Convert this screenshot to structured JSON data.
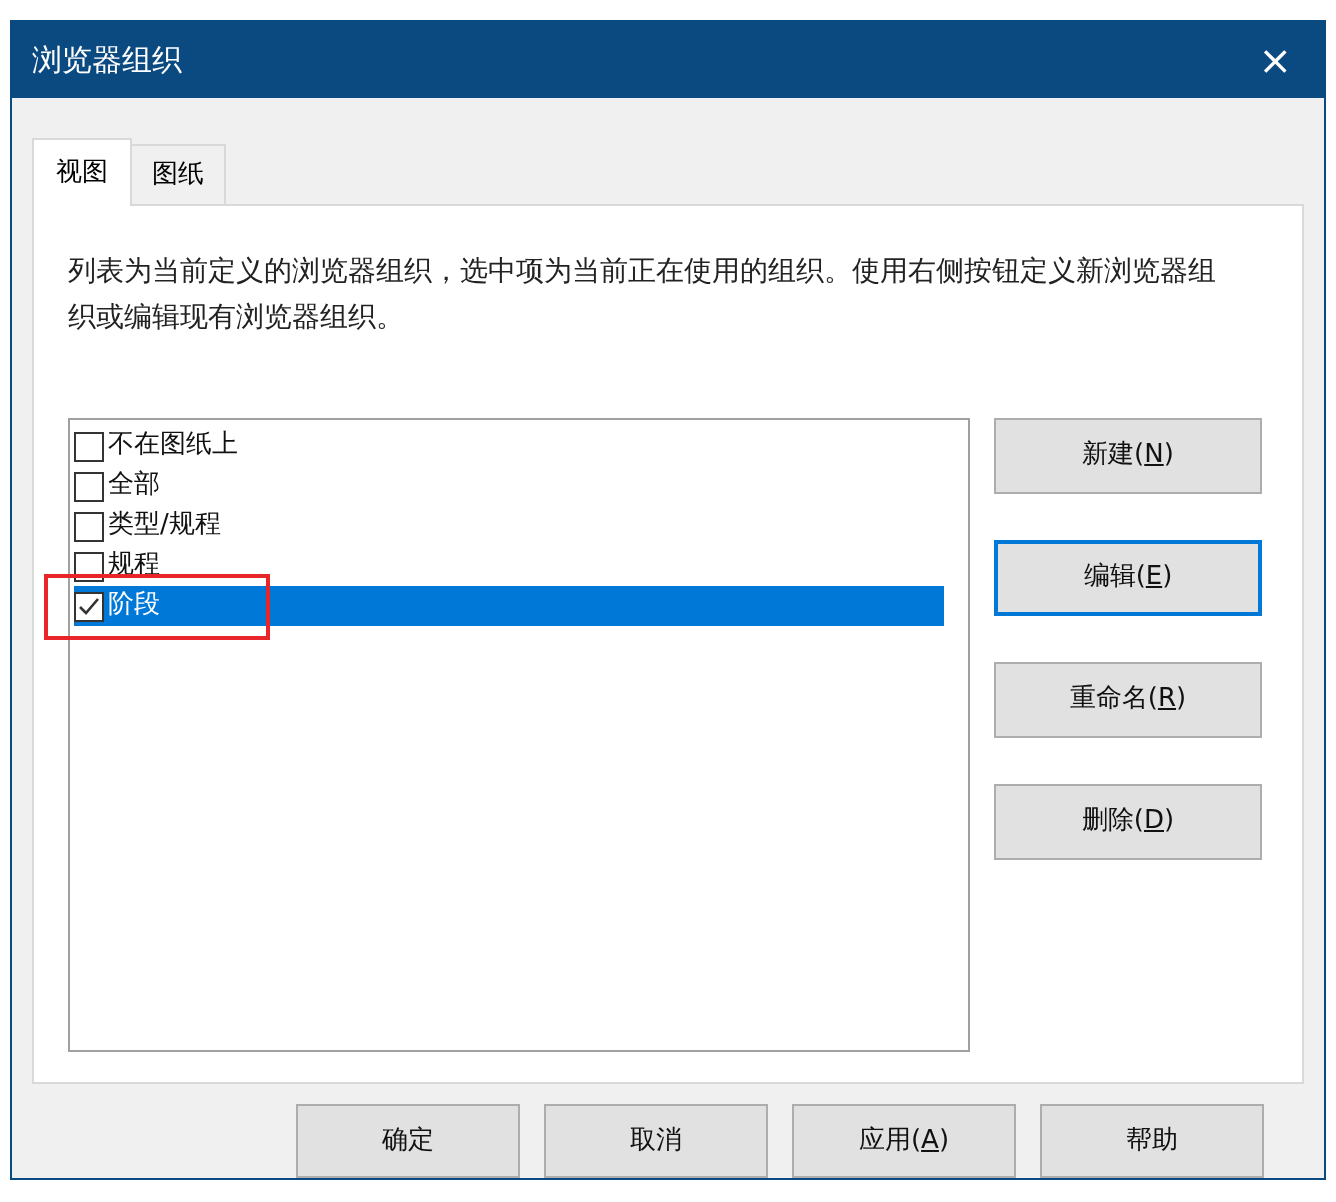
{
  "window": {
    "title": "浏览器组织",
    "close": "×"
  },
  "tabs": [
    {
      "label": "视图",
      "selected": true
    },
    {
      "label": "图纸",
      "selected": false
    }
  ],
  "description": "列表为当前定义的浏览器组织，选中项为当前正在使用的组织。使用右侧按钮定义新浏览器组织或编辑现有浏览器组织。",
  "list": [
    {
      "label": "不在图纸上",
      "checked": false,
      "selected": false,
      "highlighted": false
    },
    {
      "label": "全部",
      "checked": false,
      "selected": false,
      "highlighted": false
    },
    {
      "label": "类型/规程",
      "checked": false,
      "selected": false,
      "highlighted": false
    },
    {
      "label": "规程",
      "checked": false,
      "selected": false,
      "highlighted": false
    },
    {
      "label": "阶段",
      "checked": true,
      "selected": true,
      "highlighted": true
    }
  ],
  "side_buttons": [
    {
      "label": "新建(",
      "key": "N",
      "suffix": ")",
      "focused": false
    },
    {
      "label": "编辑(",
      "key": "E",
      "suffix": ")",
      "focused": true
    },
    {
      "label": "重命名(",
      "key": "R",
      "suffix": ")",
      "focused": false
    },
    {
      "label": "删除(",
      "key": "D",
      "suffix": ")",
      "focused": false
    }
  ],
  "footer_buttons": [
    {
      "label": "确定"
    },
    {
      "label": "取消"
    },
    {
      "label": "应用(",
      "key": "A",
      "suffix": ")"
    },
    {
      "label": "帮助"
    }
  ]
}
